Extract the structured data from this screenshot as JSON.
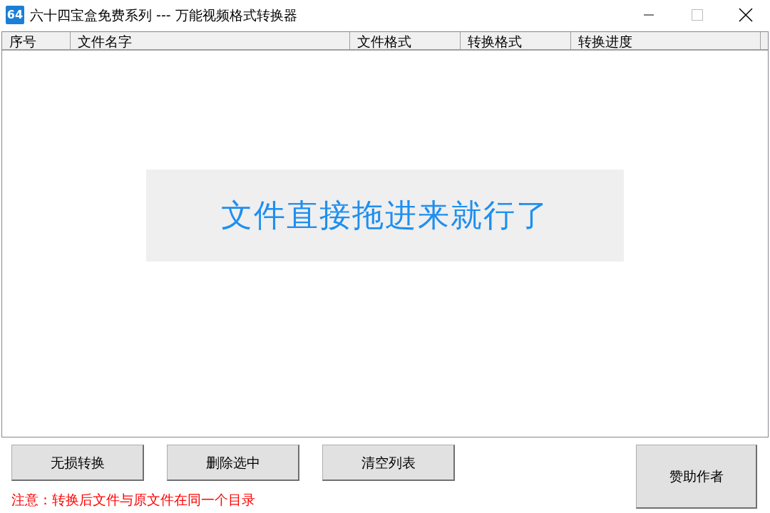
{
  "window": {
    "icon_text": "64",
    "title": "六十四宝盒免费系列 --- 万能视频格式转换器"
  },
  "columns": [
    "序号",
    "文件名字",
    "文件格式",
    "转换格式",
    "转换进度"
  ],
  "drop_hint": "文件直接拖进来就行了",
  "buttons": [
    "无损转换",
    "删除选中",
    "清空列表"
  ],
  "sponsor_button": "赞助作者",
  "note": "注意：转换后文件与原文件在同一个目录"
}
